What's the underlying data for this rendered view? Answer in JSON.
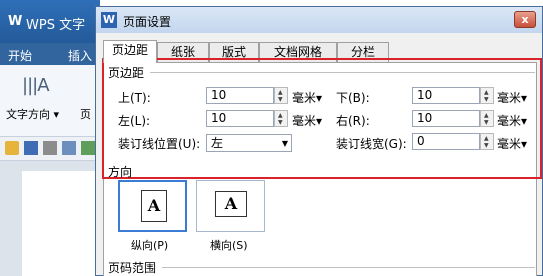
{
  "app": {
    "logo": "W",
    "title": "WPS 文字",
    "menu": [
      "开始",
      "插入"
    ],
    "ribbon": {
      "text_direction": "文字方向",
      "page_margin": "页"
    }
  },
  "dialog": {
    "logo": "W",
    "title": "页面设置",
    "close": "x",
    "tabs": [
      "页边距",
      "纸张",
      "版式",
      "文档网格",
      "分栏"
    ],
    "active_tab": 0,
    "margins": {
      "section": "页边距",
      "top": {
        "label": "上(T):",
        "value": "10",
        "unit": "毫米"
      },
      "bottom": {
        "label": "下(B):",
        "value": "10",
        "unit": "毫米"
      },
      "left": {
        "label": "左(L):",
        "value": "10",
        "unit": "毫米"
      },
      "right": {
        "label": "右(R):",
        "value": "10",
        "unit": "毫米"
      },
      "gutter_pos": {
        "label": "装订线位置(U):",
        "value": "左"
      },
      "gutter_width": {
        "label": "装订线宽(G):",
        "value": "0",
        "unit": "毫米"
      }
    },
    "orientation": {
      "section": "方向",
      "portrait": {
        "glyph": "A",
        "label": "纵向(P)"
      },
      "landscape": {
        "glyph": "A",
        "label": "横向(S)"
      },
      "selected": "portrait"
    },
    "page_range": {
      "section": "页码范围"
    }
  },
  "colors": {
    "highlight": "#d9222a",
    "title_blue": "#2f6fb8",
    "selection_blue": "#3a7bd5"
  }
}
